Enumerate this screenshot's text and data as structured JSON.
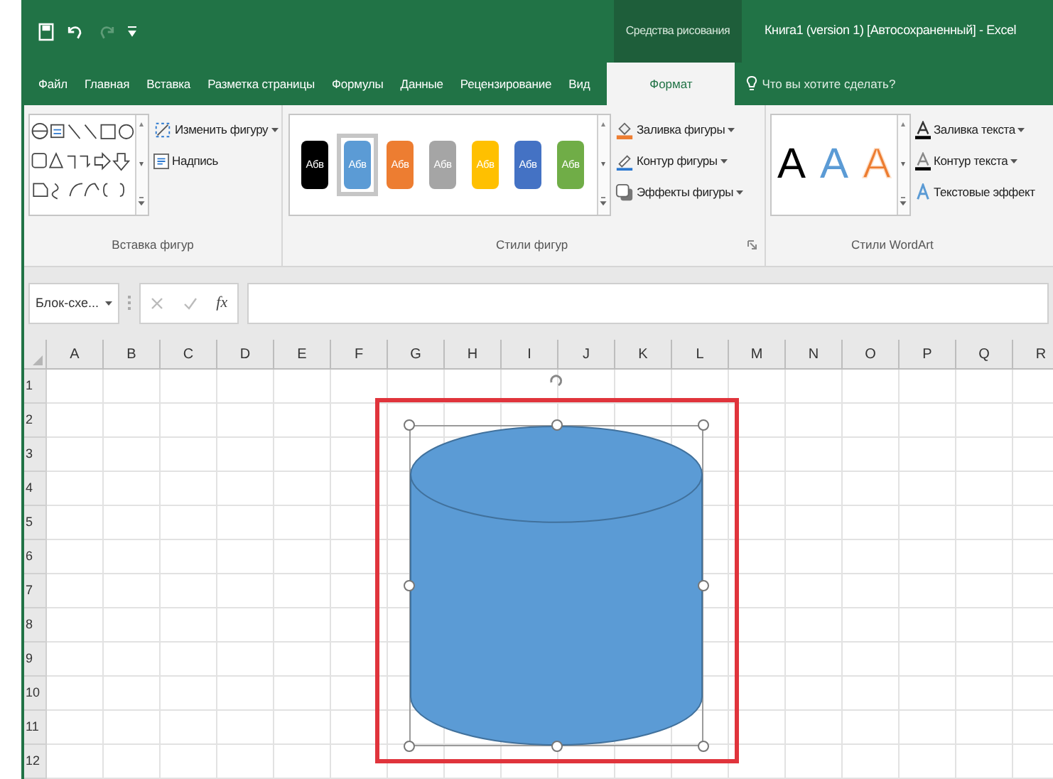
{
  "window": {
    "title": "Книга1 (version 1) [Автосохраненный] - Excel",
    "context_group": "Средства рисования"
  },
  "quick_access": {
    "redo_enabled": false
  },
  "tabs": [
    {
      "label": "Файл",
      "selected": false
    },
    {
      "label": "Главная",
      "selected": false
    },
    {
      "label": "Вставка",
      "selected": false
    },
    {
      "label": "Разметка страницы",
      "selected": false
    },
    {
      "label": "Формулы",
      "selected": false
    },
    {
      "label": "Данные",
      "selected": false
    },
    {
      "label": "Рецензирование",
      "selected": false
    },
    {
      "label": "Вид",
      "selected": false
    },
    {
      "label": "Формат",
      "selected": true
    }
  ],
  "tell_me": {
    "placeholder": "Что вы хотите сделать?"
  },
  "ribbon": {
    "groups": [
      {
        "label": "Вставка фигур",
        "buttons": [
          {
            "label": "Изменить фигуру",
            "dropdown": true
          },
          {
            "label": "Надпись",
            "dropdown": false
          }
        ]
      },
      {
        "label": "Стили фигур",
        "swatches": [
          {
            "label": "Абв",
            "color": "#000000",
            "selected": false
          },
          {
            "label": "Абв",
            "color": "#5b9bd5",
            "selected": true
          },
          {
            "label": "Абв",
            "color": "#ed7d31",
            "selected": false
          },
          {
            "label": "Абв",
            "color": "#a5a5a5",
            "selected": false
          },
          {
            "label": "Абв",
            "color": "#ffc000",
            "selected": false
          },
          {
            "label": "Абв",
            "color": "#4472c4",
            "selected": false
          },
          {
            "label": "Абв",
            "color": "#70ad47",
            "selected": false
          }
        ],
        "buttons": [
          {
            "label": "Заливка фигуры",
            "dropdown": true
          },
          {
            "label": "Контур фигуры",
            "dropdown": true
          },
          {
            "label": "Эффекты фигуры",
            "dropdown": true
          }
        ]
      },
      {
        "label": "Стили WordArt",
        "wordart": [
          {
            "label": "A",
            "color": "#000000",
            "kind": "solid"
          },
          {
            "label": "A",
            "color": "#5b9bd5",
            "kind": "solid"
          },
          {
            "label": "A",
            "color": "#ed7d31",
            "kind": "outline"
          }
        ],
        "buttons": [
          {
            "label": "Заливка текста",
            "dropdown": true
          },
          {
            "label": "Контур текста",
            "dropdown": true
          },
          {
            "label": "Текстовые эффект",
            "dropdown": false
          }
        ]
      }
    ]
  },
  "formula_bar": {
    "name_box": "Блок-схе...",
    "fx": "fx"
  },
  "sheet": {
    "columns": [
      "A",
      "B",
      "C",
      "D",
      "E",
      "F",
      "G",
      "H",
      "I",
      "J",
      "K",
      "L",
      "M",
      "N",
      "O",
      "P",
      "Q",
      "R"
    ],
    "rows": [
      "1",
      "2",
      "3",
      "4",
      "5",
      "6",
      "7",
      "8",
      "9",
      "10",
      "11",
      "12"
    ]
  },
  "shape": {
    "kind": "cylinder",
    "color": "#5b9bd5",
    "selected": true
  },
  "highlight_frame": true
}
